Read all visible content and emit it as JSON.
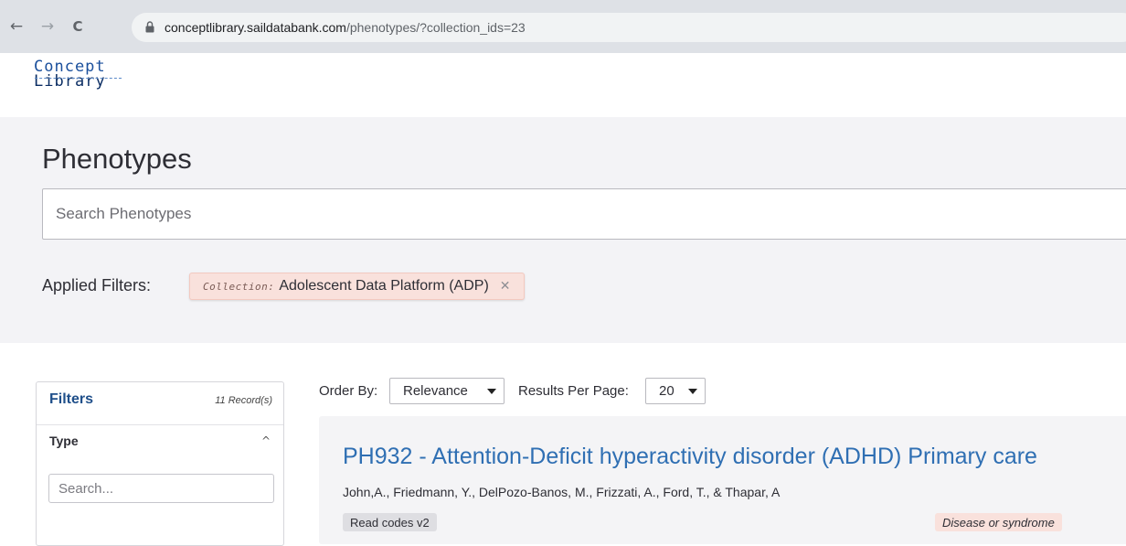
{
  "browser": {
    "back_icon": "←",
    "forward_icon": "→",
    "reload_icon": "C",
    "url_host": "conceptlibrary.saildatabank.com",
    "url_path": "/phenotypes/?collection_ids=23"
  },
  "header": {
    "logo_line1": "Concept",
    "logo_line2": "Library"
  },
  "hero": {
    "title": "Phenotypes",
    "search_placeholder": "Search Phenotypes",
    "applied_filters_label": "Applied Filters:",
    "chip": {
      "key": "Collection:",
      "value": "Adolescent Data Platform (ADP)",
      "remove_icon": "✕"
    }
  },
  "filters": {
    "title": "Filters",
    "records": "11 Record(s)",
    "type_label": "Type",
    "type_caret": "^",
    "search_placeholder": "Search..."
  },
  "controls": {
    "order_label": "Order By:",
    "order_value": "Relevance",
    "rpp_label": "Results Per Page:",
    "rpp_value": "20"
  },
  "results": [
    {
      "title": "PH932 - Attention-Deficit hyperactivity disorder (ADHD) Primary care",
      "authors": "John,A., Friedmann, Y., DelPozo-Banos, M., Frizzati, A., Ford, T., & Thapar, A",
      "coding_tag": "Read codes v2",
      "type_tag": "Disease or syndrome"
    }
  ],
  "colors": {
    "link": "#2f6fb3",
    "chip_bg": "#f9e1dc",
    "hero_bg": "#f3f3f6",
    "filters_title": "#1f4f8a"
  }
}
